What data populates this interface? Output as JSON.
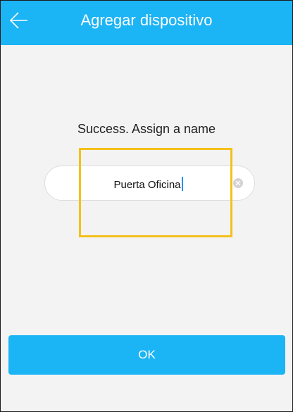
{
  "header": {
    "title": "Agregar dispositivo",
    "back_icon": "arrow-left-icon",
    "background_color": "#1bb4f5"
  },
  "main": {
    "prompt": "Success. Assign a name",
    "name_input": {
      "value": "Puerta Oficina",
      "clear_icon": "clear-circle-icon"
    },
    "highlight_color": "#f4c11a"
  },
  "footer": {
    "ok_label": "OK",
    "button_color": "#1bb4f5"
  }
}
